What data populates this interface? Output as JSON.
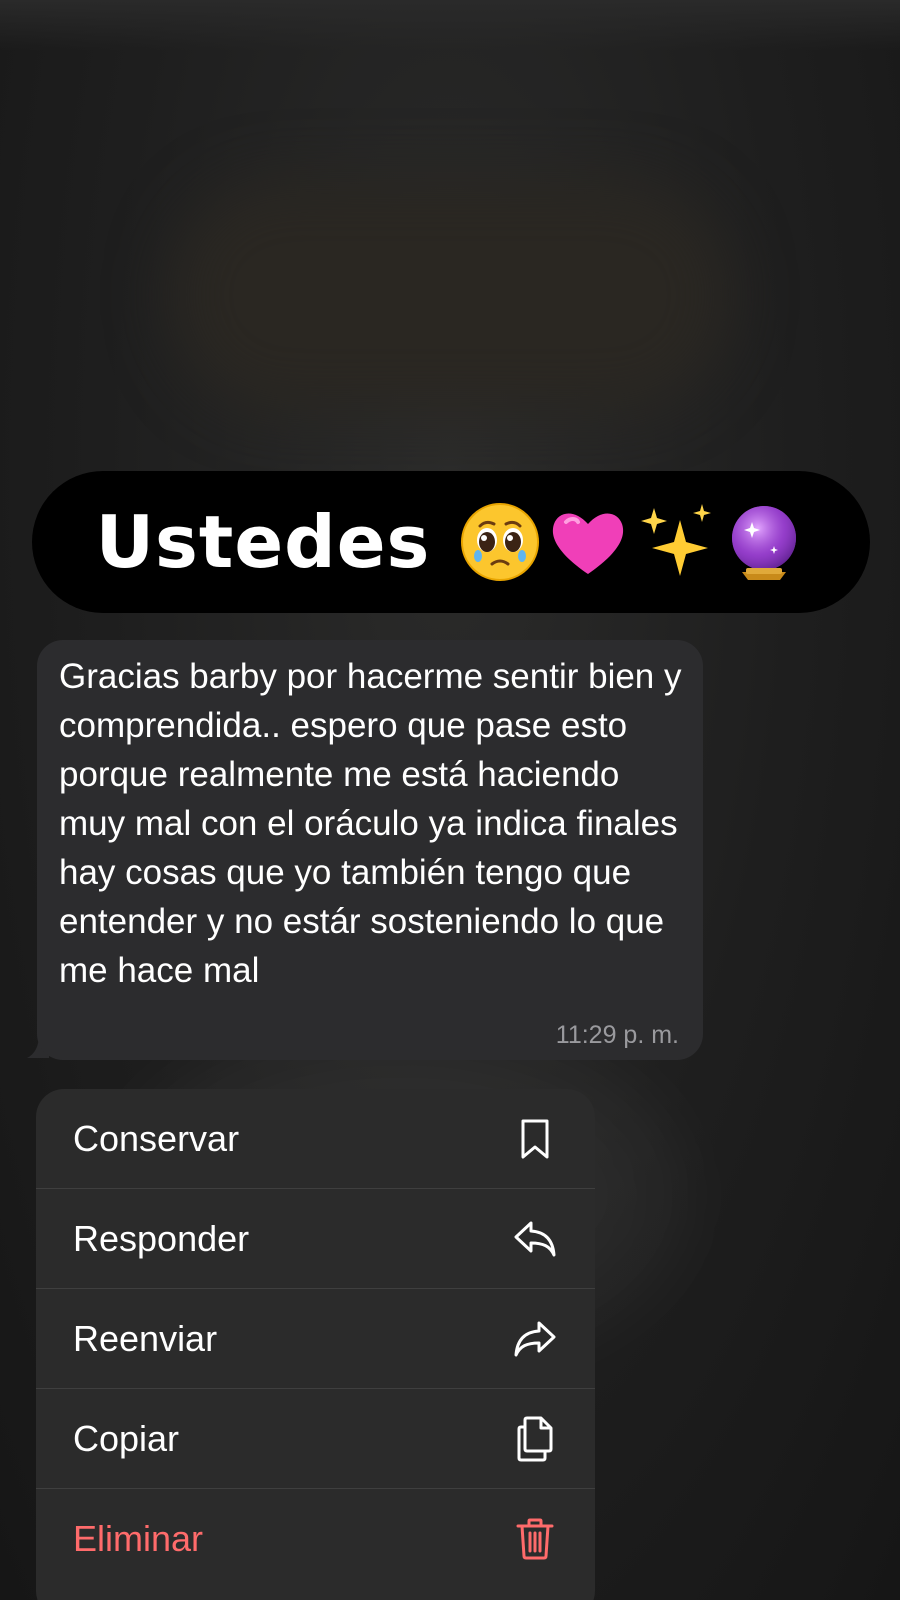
{
  "sticker": {
    "text": "Ustedes",
    "emojis": [
      "pleading-face",
      "pink-heart",
      "sparkles",
      "crystal-ball"
    ]
  },
  "message": {
    "text": "Gracias barby por hacerme sentir bien y comprendida.. espero que pase esto porque realmente me está haciendo muy mal con el oráculo ya indica finales hay cosas que yo también tengo que entender y no estár sosteniendo lo que me hace mal",
    "time": "11:29 p. m."
  },
  "menu": {
    "items": [
      {
        "label": "Conservar",
        "icon": "bookmark-icon"
      },
      {
        "label": "Responder",
        "icon": "reply-icon"
      },
      {
        "label": "Reenviar",
        "icon": "forward-icon"
      },
      {
        "label": "Copiar",
        "icon": "copy-icon"
      },
      {
        "label": "Eliminar",
        "icon": "trash-icon",
        "color": "#ff6b6b"
      }
    ]
  },
  "colors": {
    "bubble": "#2c2c2e",
    "menu": "#2b2b2b",
    "danger": "#ff6b6b"
  }
}
